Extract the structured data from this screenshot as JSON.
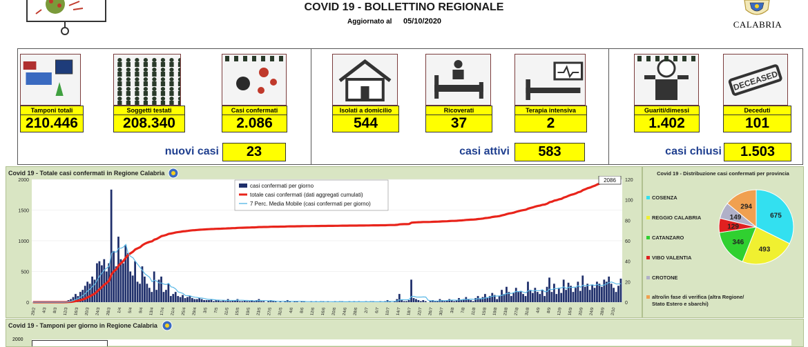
{
  "header": {
    "title": "COVID 19 - BOLLETTINO REGIONALE",
    "updated_label": "Aggiornato al",
    "updated_date": "05/10/2020",
    "region_logo_text": "CALABRIA"
  },
  "kpis": [
    {
      "label": "Tamponi totali",
      "value": "210.446",
      "icon": "lab-equipment-icon"
    },
    {
      "label": "Soggetti testati",
      "value": "208.340",
      "icon": "people-grid-icon"
    },
    {
      "label": "Casi confermati",
      "value": "2.086",
      "icon": "virus-patient-icon"
    },
    {
      "label": "Isolati a domicilio",
      "value": "544",
      "icon": "house-icon"
    },
    {
      "label": "Ricoverati",
      "value": "37",
      "icon": "hospital-bed-icon"
    },
    {
      "label": "Terapia intensiva",
      "value": "2",
      "icon": "icu-bed-icon"
    },
    {
      "label": "Guariti/dimessi",
      "value": "1.402",
      "icon": "recovered-person-icon"
    },
    {
      "label": "Deceduti",
      "value": "101",
      "icon": "deceased-stamp-icon"
    }
  ],
  "summaries": [
    {
      "label": "nuovi casi",
      "value": "23"
    },
    {
      "label": "casi attivi",
      "value": "583"
    },
    {
      "label": "casi chiusi",
      "value": "1.503"
    }
  ],
  "colors": {
    "yellow": "#ffff00",
    "bar": "#1f2f6b",
    "cumulative": "#e8241b",
    "moving_avg": "#5ab8e6",
    "chart_bg": "#d9e5c3"
  },
  "chart_data": [
    {
      "type": "bar",
      "title": "Covid 19 - Totale casi confermati in Regione Calabria",
      "legend": [
        "casi confermati per giorno",
        "totale casi confermati (dati aggregati cumulati)",
        "7 Perc. Media Mobile (casi confermati per giorno)"
      ],
      "legend_position": "top-center",
      "left_axis_ticks": [
        "0",
        "500",
        "1000",
        "1500",
        "2000"
      ],
      "right_axis_ticks": [
        "0",
        "20",
        "40",
        "60",
        "80",
        "100",
        "120"
      ],
      "left_ylim": [
        0,
        2000
      ],
      "right_ylim": [
        0,
        120
      ],
      "end_annotation": "2086",
      "x_range": [
        "26/2",
        "5/10"
      ],
      "x_ticks": [
        "29/2",
        "4/3",
        "8/3",
        "12/3",
        "16/3",
        "20/3",
        "24/3",
        "28/3",
        "1/4",
        "5/4",
        "9/4",
        "13/4",
        "17/4",
        "21/4",
        "25/4",
        "29/4",
        "3/5",
        "7/5",
        "11/5",
        "15/5",
        "19/5",
        "23/5",
        "27/5",
        "31/5",
        "4/6",
        "8/6",
        "12/6",
        "16/6",
        "20/6",
        "24/6",
        "28/6",
        "2/7",
        "6/7",
        "10/7",
        "14/7",
        "18/7",
        "22/7",
        "26/7",
        "30/7",
        "3/8",
        "7/8",
        "11/8",
        "15/8",
        "19/8",
        "23/8",
        "27/8",
        "31/8",
        "4/9",
        "8/9",
        "12/9",
        "16/9",
        "20/9",
        "24/9",
        "28/9",
        "2/10"
      ],
      "series": [
        {
          "name": "casi confermati per giorno",
          "axis": "right",
          "values": [
            0,
            0,
            0,
            0,
            0,
            0,
            0,
            0,
            0,
            0,
            0,
            0,
            0,
            0,
            1,
            2,
            3,
            5,
            8,
            6,
            10,
            12,
            16,
            20,
            18,
            25,
            22,
            38,
            40,
            36,
            42,
            30,
            38,
            110,
            50,
            35,
            64,
            42,
            38,
            56,
            48,
            30,
            26,
            40,
            20,
            18,
            35,
            25,
            18,
            14,
            10,
            30,
            12,
            22,
            25,
            10,
            12,
            18,
            6,
            8,
            10,
            6,
            5,
            7,
            4,
            5,
            6,
            4,
            3,
            3,
            4,
            3,
            2,
            2,
            2,
            3,
            1,
            2,
            2,
            1,
            2,
            1,
            3,
            1,
            2,
            2,
            3,
            1,
            1,
            2,
            1,
            1,
            2,
            1,
            2,
            3,
            1,
            1,
            0,
            1,
            2,
            1,
            1,
            0,
            1,
            0,
            1,
            2,
            1,
            0,
            1,
            1,
            0,
            1,
            1,
            0,
            0,
            1,
            0,
            1,
            0,
            1,
            1,
            0,
            1,
            0,
            0,
            1,
            0,
            1,
            1,
            0,
            0,
            1,
            0,
            1,
            0,
            1,
            0,
            0,
            1,
            0,
            1,
            1,
            0,
            0,
            1,
            0,
            1,
            2,
            1,
            0,
            1,
            3,
            8,
            2,
            1,
            1,
            2,
            22,
            4,
            3,
            2,
            1,
            2,
            1,
            0,
            1,
            2,
            1,
            1,
            3,
            2,
            1,
            2,
            3,
            2,
            1,
            2,
            4,
            2,
            3,
            5,
            3,
            2,
            1,
            4,
            6,
            3,
            5,
            8,
            4,
            6,
            9,
            7,
            3,
            6,
            12,
            8,
            15,
            10,
            6,
            9,
            14,
            10,
            11,
            8,
            6,
            20,
            12,
            9,
            14,
            10,
            8,
            12,
            6,
            15,
            24,
            10,
            18,
            8,
            14,
            9,
            22,
            12,
            19,
            16,
            10,
            14,
            20,
            11,
            26,
            15,
            18,
            12,
            17,
            14,
            20,
            18,
            15,
            22,
            20,
            25,
            18,
            14,
            10,
            16,
            23
          ]
        },
        {
          "name": "totale casi confermati (dati aggregati cumulati)",
          "axis": "left"
        },
        {
          "name": "7 Perc. Media Mobile (casi confermati per giorno)",
          "axis": "right"
        }
      ]
    },
    {
      "type": "pie",
      "title": "Covid 19 - Distribuzione casi confermati per provincia",
      "categories": [
        "COSENZA",
        "REGGIO CALABRIA",
        "CATANZARO",
        "VIBO VALENTIA",
        "CROTONE",
        "altro/in fase di verifica (altra Regione/ Stato Estero e sbarchi)"
      ],
      "values": [
        675,
        493,
        346,
        129,
        149,
        294
      ],
      "colors": [
        "#33e0f0",
        "#f0f030",
        "#30d030",
        "#e02020",
        "#b0b0c8",
        "#f0a050"
      ]
    },
    {
      "type": "bar",
      "title": "Covid 19 - Tamponi per giorno in Regione Calabria",
      "y_ticks": [
        "2000"
      ]
    }
  ]
}
